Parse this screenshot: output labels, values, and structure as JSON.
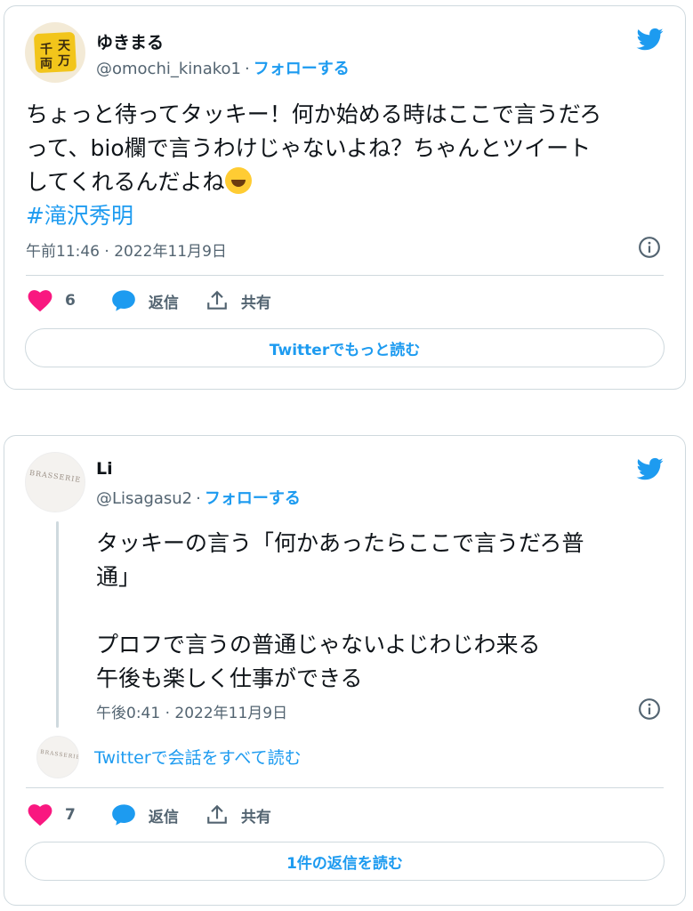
{
  "tweets": [
    {
      "name": "ゆきまる",
      "handle": "@omochi_kinako1",
      "separator": "·",
      "follow_label": "フォローする",
      "avatar_text": [
        "千",
        "天",
        "両",
        "万"
      ],
      "text_lines": [
        "ちょっと待ってタッキー！何か始める時はここで言うだろ",
        "って、bio欄で言うわけじゃないよね？ちゃんとツイート",
        "してくれるんだよね"
      ],
      "hashtag": "#滝沢秀明",
      "timestamp": "午前11:46 · 2022年11月9日",
      "likes": "6",
      "reply_label": "返信",
      "share_label": "共有",
      "button_label": "Twitterでもっと読む"
    },
    {
      "name": "Li",
      "handle": "@Lisagasu2",
      "separator": "·",
      "follow_label": "フォローする",
      "avatar_text": "BRASSERIE",
      "text_lines": [
        "タッキーの言う「何かあったらここで言うだろ普",
        "通」",
        "",
        "プロフで言うの普通じゃないよじわじわ来る",
        "午後も楽しく仕事ができる"
      ],
      "timestamp": "午後0:41 · 2022年11月9日",
      "conversation_label": "Twitterで会話をすべて読む",
      "likes": "7",
      "reply_label": "返信",
      "share_label": "共有",
      "button_label": "1件の返信を読む"
    }
  ],
  "colors": {
    "accent": "#1d9bf0",
    "like": "#f91880",
    "muted": "#536471",
    "border": "#cfd9de"
  }
}
